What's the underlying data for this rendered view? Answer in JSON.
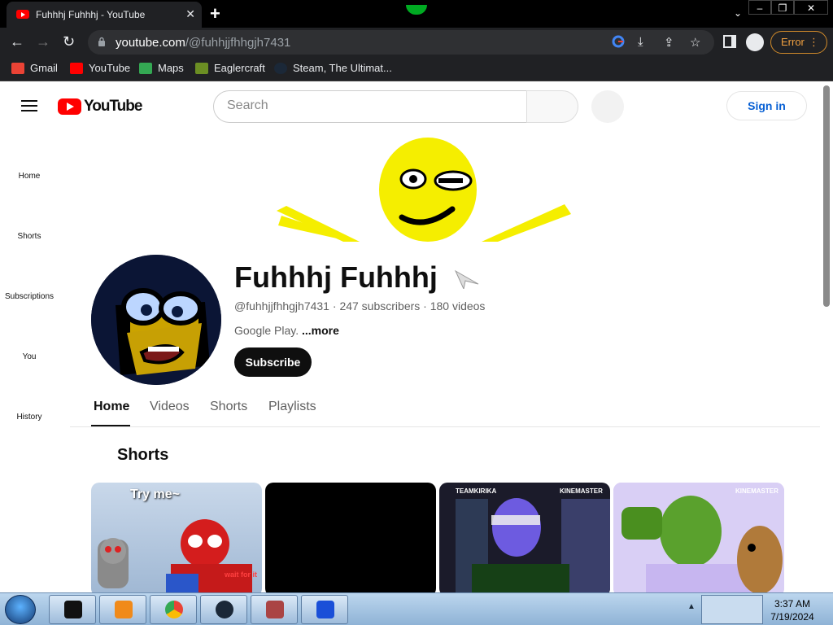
{
  "browser": {
    "tab_title": "Fuhhhj Fuhhhj - YouTube",
    "url_host": "youtube.com",
    "url_path": "/@fuhhjjfhhgjh7431",
    "profile_status": "Error",
    "bookmarks": [
      {
        "label": "Gmail",
        "icon": "gmail-icon",
        "color": "#ea4335"
      },
      {
        "label": "YouTube",
        "icon": "youtube-icon",
        "color": "#ff0000"
      },
      {
        "label": "Maps",
        "icon": "maps-icon",
        "color": "#34a853"
      },
      {
        "label": "Eaglercraft",
        "icon": "eaglercraft-icon",
        "color": "#6b8e23"
      },
      {
        "label": "Steam, The Ultimat...",
        "icon": "steam-icon",
        "color": "#1b2838"
      }
    ]
  },
  "youtube": {
    "logo_text": "YouTube",
    "search_placeholder": "Search",
    "sign_in": "Sign in",
    "guide": [
      "Home",
      "Shorts",
      "Subscriptions",
      "You",
      "History"
    ]
  },
  "channel": {
    "name": "Fuhhhj Fuhhhj",
    "handle": "@fuhhjjfhhgjh7431",
    "subscribers": "247 subscribers",
    "videos": "180 videos",
    "description": "Google Play.",
    "more": "...more",
    "subscribe": "Subscribe",
    "tabs": [
      "Home",
      "Videos",
      "Shorts",
      "Playlists"
    ],
    "active_tab": "Home"
  },
  "shorts": {
    "title": "Shorts",
    "items": [
      {
        "caption": "Try me~",
        "subcaption": "wait for it"
      },
      {
        "caption": ""
      },
      {
        "caption": "TEAMKIRIKA",
        "subcaption": "KINEMASTER"
      },
      {
        "caption": "KINEMASTER"
      }
    ]
  },
  "taskbar": {
    "apps": [
      "terminal-app",
      "media-player-app",
      "chrome-app",
      "steam-app",
      "game-app",
      "malwarebytes-app"
    ],
    "time": "3:37 AM",
    "date": "7/19/2024"
  }
}
